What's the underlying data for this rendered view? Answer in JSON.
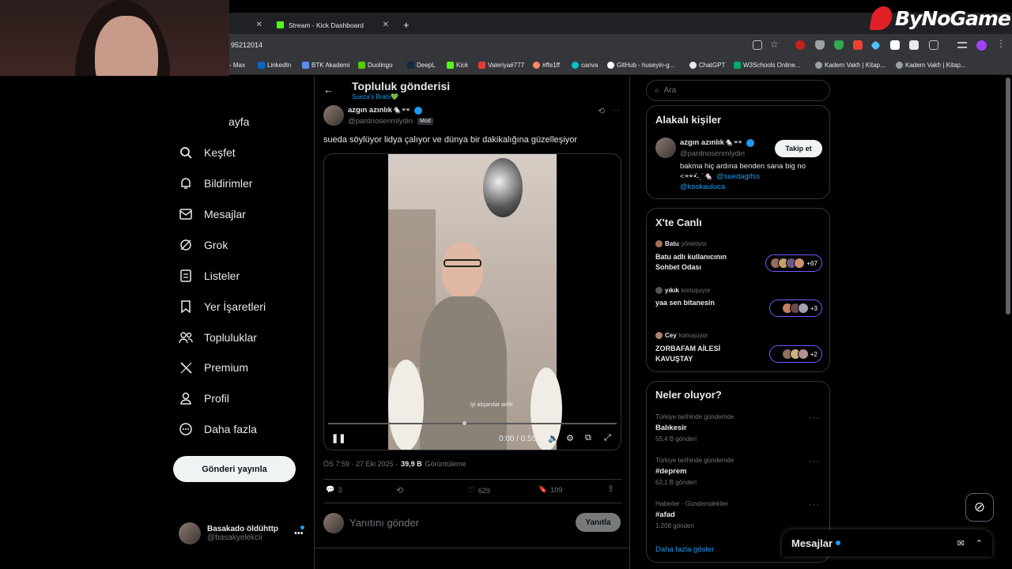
{
  "browser": {
    "tabs": [
      {
        "label": ""
      },
      {
        "label": "Stream - Kick Dashboard"
      }
    ],
    "url": "95212014",
    "bookmarks": [
      "- Max",
      "LinkedIn",
      "BTK Akademi",
      "Duolingo",
      "DeepL",
      "Kick",
      "Valeriya#777",
      "#ffe1ff",
      "canva",
      "GitHub - huseyin-g...",
      "ChatGPT",
      "W3Schools Online...",
      "Kadem Vakfı | Kitap...",
      "Kadem Vakfı | Kitap..."
    ]
  },
  "overlay_logo": "ByNoGame",
  "sidebar": {
    "items": [
      {
        "label": "ayfa",
        "icon": "home-icon"
      },
      {
        "label": "Keşfet",
        "icon": "search-icon"
      },
      {
        "label": "Bildirimler",
        "icon": "bell-icon"
      },
      {
        "label": "Mesajlar",
        "icon": "mail-icon"
      },
      {
        "label": "Grok",
        "icon": "grok-icon"
      },
      {
        "label": "Listeler",
        "icon": "list-icon"
      },
      {
        "label": "Yer İşaretleri",
        "icon": "bookmark-icon"
      },
      {
        "label": "Topluluklar",
        "icon": "communities-icon"
      },
      {
        "label": "Premium",
        "icon": "x-icon"
      },
      {
        "label": "Profil",
        "icon": "person-icon"
      },
      {
        "label": "Daha fazla",
        "icon": "more-circle-icon"
      }
    ],
    "post_button": "Gönderi yayınla",
    "account": {
      "name": "Basakado öldühttp",
      "handle": "@basakyelekcii"
    }
  },
  "post": {
    "header_title": "Topluluk gönderisi",
    "community": "Sueza's Brats💚",
    "author_name": "azgın azınlık🐁👓",
    "author_handle": "@pardnosenmlydin",
    "mod_badge": "Mod",
    "text": "sueda söylüyor lidya çalıyor ve dünya bir dakikalığına güzelleşiyor",
    "caption": "iyi akşamlar anlık",
    "time_display": "0:00 / 0:55",
    "timestamp": "ÖS 7:59 · 27 Eki 2025 ·",
    "views_count": "39,9 B",
    "views_label": "Görüntüleme",
    "replies": "3",
    "reposts": "",
    "likes": "629",
    "bookmarks": "109",
    "reply_placeholder": "Yanıtını gönder",
    "reply_button": "Yanıtla"
  },
  "right": {
    "search_placeholder": "Ara",
    "relevant_title": "Alakalı kişiler",
    "person": {
      "name": "azgın azınlık🐁👓",
      "handle": "@pardnosenmlydin",
      "follow": "Takip et",
      "bio": "bakma hiç ardına benden sana big no",
      "bio2": "<👓•᷄˗ˏˋ🐁",
      "mention1": "@suedagifss",
      "mention2": "@koskauluca"
    },
    "live_title": "X'te Canlı",
    "live": [
      {
        "host": "Batu",
        "role": "yönetiyor",
        "title": "Batu adlı kullanıcının Sohbet Odası",
        "count": "+67"
      },
      {
        "host": "yıkık",
        "role": "konuşuyor",
        "title": "yaa sen bitanesin",
        "count": "+3"
      },
      {
        "host": "Cey",
        "role": "konuşuyor",
        "title": "ZORBAFAM AİLESİ KAVUŞTAY",
        "count": "+2"
      }
    ],
    "trends_title": "Neler oluyor?",
    "trends": [
      {
        "context": "Türkiye tarihinde gündemde",
        "name": "Balıkesir",
        "posts": "55,4 B gönderi"
      },
      {
        "context": "Türkiye tarihinde gündemde",
        "name": "#deprem",
        "posts": "62,1 B gönderi"
      },
      {
        "context": "Haberler · Gündemdekiler",
        "name": "#afad",
        "posts": "1.208 gönderi"
      }
    ],
    "show_more": "Daha fazla göster",
    "messages_dock": "Mesajlar"
  },
  "colors": {
    "accent": "#1d9bf0",
    "live": "#7856ff",
    "brand": "#e01f26"
  }
}
